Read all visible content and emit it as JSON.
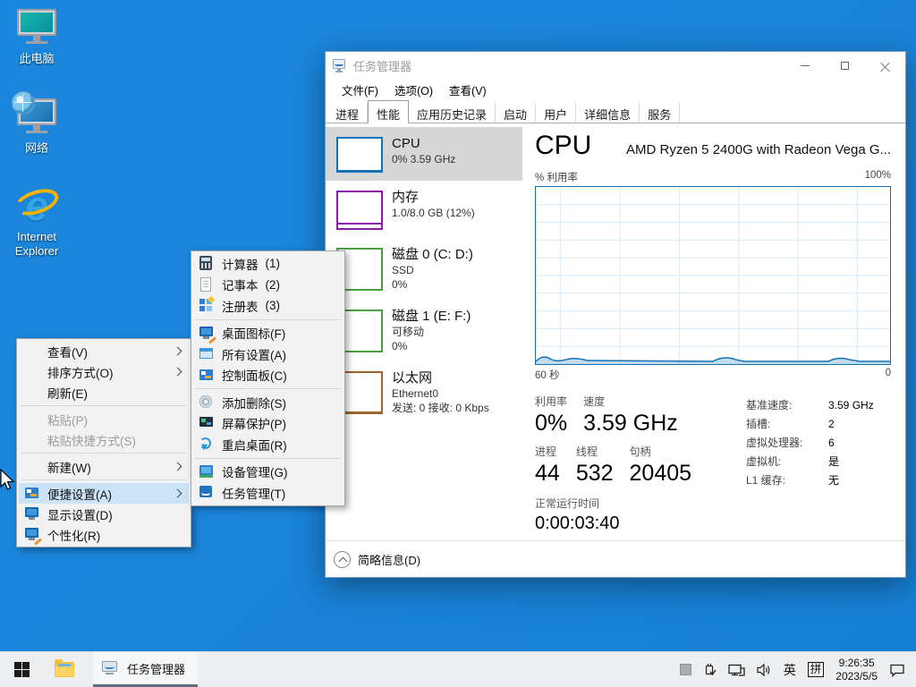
{
  "colors": {
    "desktop_blue": "#1a85da",
    "accent_cpu": "#1371b5",
    "memory_purple": "#8c1aad",
    "disk_green": "#4a9e3f",
    "ethernet_brown": "#a0642c",
    "menu_highlight": "#cbe3f6",
    "selected_row_gray": "#d6d6d6"
  },
  "desktop": {
    "icons": [
      {
        "label": "此电脑"
      },
      {
        "label": "网络"
      },
      {
        "label": "Internet Explorer"
      }
    ]
  },
  "context_menu": {
    "items": [
      {
        "label": "查看(V)"
      },
      {
        "label": "排序方式(O)"
      },
      {
        "label": "刷新(E)"
      },
      {
        "label": "粘贴(P)"
      },
      {
        "label": "粘贴快捷方式(S)"
      },
      {
        "label": "新建(W)"
      },
      {
        "label": "便捷设置(A)"
      },
      {
        "label": "显示设置(D)"
      },
      {
        "label": "个性化(R)"
      }
    ]
  },
  "quick_menu": {
    "items": [
      {
        "label": "计算器",
        "num": "(1)"
      },
      {
        "label": "记事本",
        "num": "(2)"
      },
      {
        "label": "注册表",
        "num": "(3)"
      },
      {
        "label": "桌面图标(F)"
      },
      {
        "label": "所有设置(A)"
      },
      {
        "label": "控制面板(C)"
      },
      {
        "label": "添加删除(S)"
      },
      {
        "label": "屏幕保护(P)"
      },
      {
        "label": "重启桌面(R)"
      },
      {
        "label": "设备管理(G)"
      },
      {
        "label": "任务管理(T)"
      }
    ]
  },
  "task_manager": {
    "title": "任务管理器",
    "menu": [
      {
        "label": "文件(F)"
      },
      {
        "label": "选项(O)"
      },
      {
        "label": "查看(V)"
      }
    ],
    "tabs": [
      {
        "label": "进程"
      },
      {
        "label": "性能"
      },
      {
        "label": "应用历史记录"
      },
      {
        "label": "启动"
      },
      {
        "label": "用户"
      },
      {
        "label": "详细信息"
      },
      {
        "label": "服务"
      }
    ],
    "sidebar": [
      {
        "title": "CPU",
        "sub1": "0% 3.59 GHz"
      },
      {
        "title": "内存",
        "sub1": "1.0/8.0 GB (12%)"
      },
      {
        "title": "磁盘 0 (C: D:)",
        "sub1": "SSD",
        "sub2": "0%"
      },
      {
        "title": "磁盘 1 (E: F:)",
        "sub1": "可移动",
        "sub2": "0%"
      },
      {
        "title": "以太网",
        "sub1": "Ethernet0",
        "sub2": "发送: 0 接收: 0 Kbps"
      }
    ],
    "cpu": {
      "title": "CPU",
      "subtitle": "AMD Ryzen 5 2400G with Radeon Vega G...",
      "graph_top_left": "% 利用率",
      "graph_top_right": "100%",
      "graph_bottom_left": "60 秒",
      "graph_bottom_right": "0",
      "stats": {
        "utilization_label": "利用率",
        "utilization": "0%",
        "speed_label": "速度",
        "speed": "3.59 GHz",
        "processes_label": "进程",
        "processes": "44",
        "threads_label": "线程",
        "threads": "532",
        "handles_label": "句柄",
        "handles": "20405",
        "uptime_label": "正常运行时间",
        "uptime": "0:00:03:40"
      },
      "details": [
        {
          "label": "基准速度:",
          "value": "3.59 GHz"
        },
        {
          "label": "插槽:",
          "value": "2"
        },
        {
          "label": "虚拟处理器:",
          "value": "6"
        },
        {
          "label": "虚拟机:",
          "value": "是"
        },
        {
          "label": "L1 缓存:",
          "value": "无"
        }
      ]
    },
    "footer": {
      "label": "简略信息(D)"
    }
  },
  "taskbar": {
    "task_button_label": "任务管理器",
    "tray": {
      "language": "英",
      "ime": "拼",
      "time": "9:26:35",
      "date": "2023/5/5"
    }
  }
}
